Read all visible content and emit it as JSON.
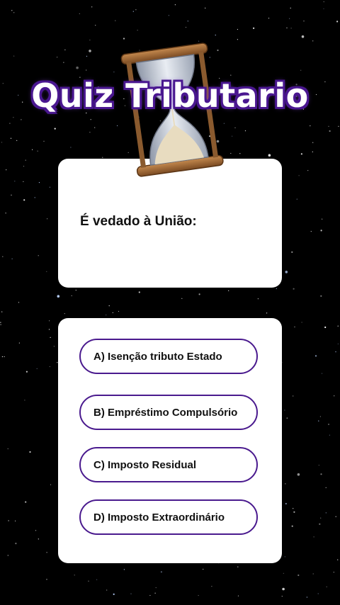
{
  "quiz": {
    "title": "Quiz Tributario",
    "question": "É vedado à União:",
    "options": [
      "A) Isenção tributo Estado",
      "B) Empréstimo Compulsório",
      "C) Imposto Residual",
      "D) Imposto Extraordinário"
    ]
  },
  "colors": {
    "background": "#000000",
    "accent": "#4a1a8e",
    "card": "#ffffff"
  },
  "icons": [
    "hourglass-icon"
  ]
}
